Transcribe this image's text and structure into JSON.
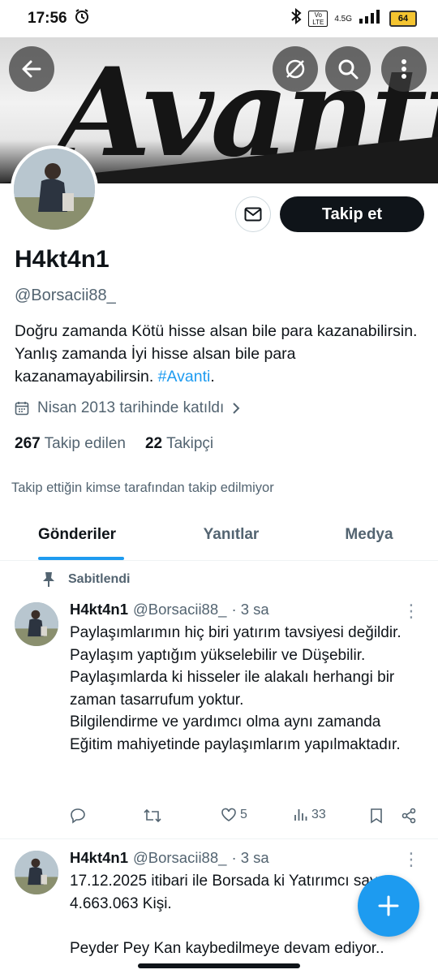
{
  "status_bar": {
    "time": "17:56",
    "network": "4.5G",
    "volte": "Vo LTE",
    "battery": "64"
  },
  "banner": {
    "text": "Avanti"
  },
  "profile": {
    "name": "H4kt4n1",
    "handle": "@Borsacii88_",
    "bio_text": "Doğru zamanda Kötü hisse alsan bile para kazanabilirsin.   Yanlış zamanda İyi  hisse alsan bile para kazanamayabilirsin.  ",
    "bio_hashtag": "#Avanti",
    "bio_end": ".",
    "joined": "Nisan 2013 tarihinde katıldı",
    "following_count": "267",
    "following_label": "Takip edilen",
    "followers_count": "22",
    "followers_label": "Takipçi",
    "follow_button": "Takip et",
    "not_followed_note": "Takip ettiğin kimse tarafından takip edilmiyor"
  },
  "tabs": [
    {
      "label": "Gönderiler"
    },
    {
      "label": "Yanıtlar"
    },
    {
      "label": "Medya"
    }
  ],
  "pinned_label": "Sabitlendi",
  "tweets": [
    {
      "name": "H4kt4n1",
      "handle": "@Borsacii88_",
      "time": "· 3 sa",
      "text": "Paylaşımlarımın hiç biri yatırım tavsiyesi değildir. Paylaşım yaptığım  yükselebilir ve Düşebilir.\nPaylaşımlarda ki hisseler ile alakalı herhangi bir zaman tasarrufum yoktur.\nBilgilendirme ve yardımcı olma aynı zamanda Eğitim mahiyetinde paylaşımlarım yapılmaktadır.",
      "likes": "5",
      "views": "33"
    },
    {
      "name": "H4kt4n1",
      "handle": "@Borsacii88_",
      "time": "· 3 sa",
      "text": "17.12.2025 itibari ile  Borsada ki Yatırımcı sayısı 4.663.063 Kişi.\n\nPeyder Pey Kan kaybedilmeye devam ediyor.."
    }
  ],
  "colors": {
    "accent": "#1d9bf0",
    "text": "#0f1419",
    "muted": "#536471"
  }
}
